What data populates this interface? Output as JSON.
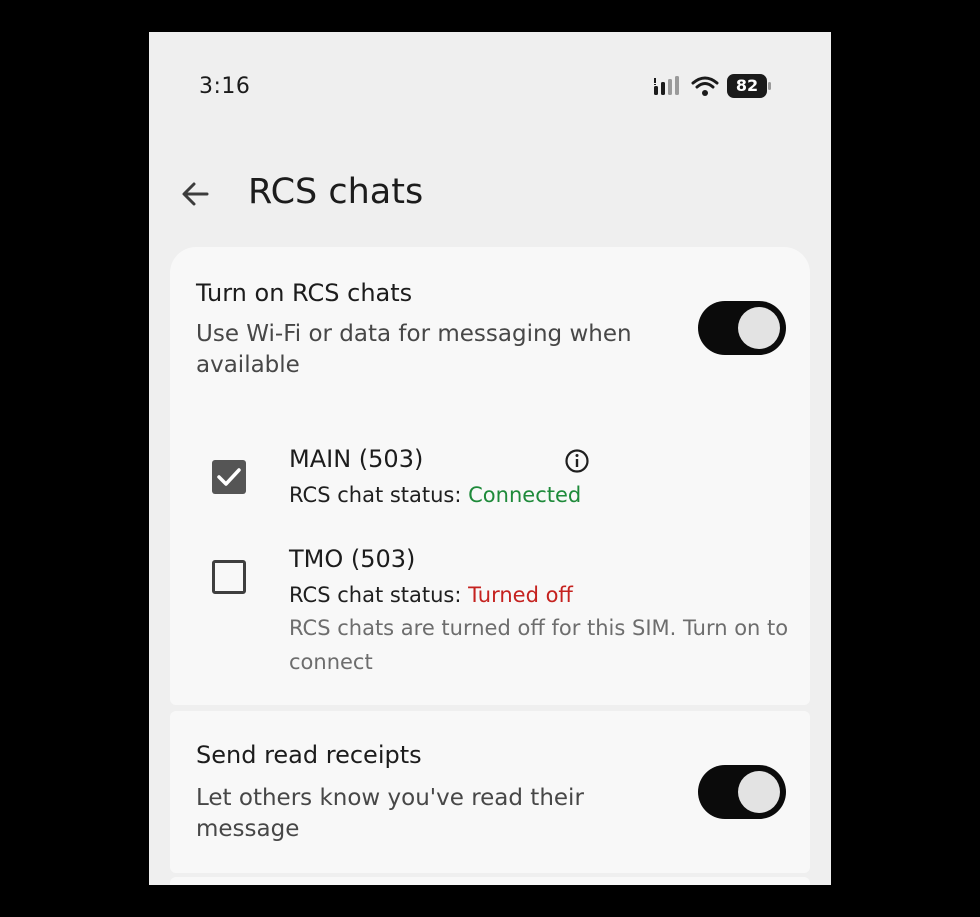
{
  "status_bar": {
    "time": "3:16",
    "battery": "82",
    "icons": [
      "signal-icon",
      "wifi-icon",
      "battery-icon"
    ]
  },
  "app_bar": {
    "back_icon": "arrow-back-icon",
    "title": "RCS chats"
  },
  "rcs_setting": {
    "title": "Turn on RCS chats",
    "description": "Use Wi-Fi or data for messaging when available",
    "enabled": true
  },
  "sims": [
    {
      "name": "MAIN (503)",
      "checked": true,
      "status_label": "RCS chat status: ",
      "status_value": "Connected",
      "status_color": "#1e8a3a",
      "has_info_icon": true
    },
    {
      "name": "TMO (503)",
      "checked": false,
      "status_label": "RCS chat status: ",
      "status_value": "Turned off",
      "status_color": "#c5221f",
      "note": "RCS chats are turned off for this SIM. Turn on to connect"
    }
  ],
  "read_receipts": {
    "title": "Send read receipts",
    "description": "Let others know you've read their message",
    "enabled": true
  },
  "colors": {
    "background": "#efefef",
    "card": "#f8f8f8",
    "toggle_on": "#0b0b0b",
    "connected": "#1e8a3a",
    "turned_off": "#c5221f"
  }
}
